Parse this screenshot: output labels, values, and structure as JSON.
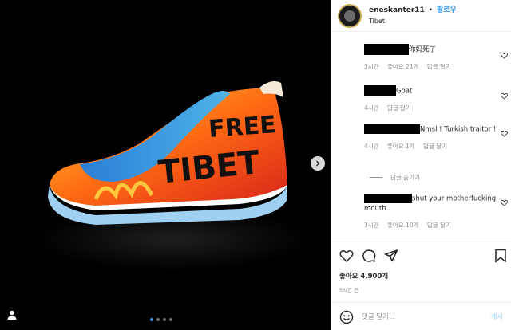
{
  "header": {
    "username": "eneskanter11",
    "separator": "•",
    "follow_label": "팔로우",
    "location": "Tibet"
  },
  "media": {
    "shoe_text_line1": "FREE",
    "shoe_text_line2": "TIBET",
    "carousel_total": 4,
    "carousel_active": 1
  },
  "comments": [
    {
      "text": "你妈死了",
      "time": "3시간",
      "likes": "좋아요 21개",
      "reply": "답글 달기"
    },
    {
      "text": "Goat",
      "time": "4시간",
      "reply": "답글 달기"
    },
    {
      "text": "Nmsl ! Turkish traitor !",
      "time": "4시간",
      "likes": "좋아요 1개",
      "reply": "답글 달기"
    },
    {
      "text": "shut your motherfucking mouth",
      "time": "3시간",
      "likes": "좋아요 10개",
      "reply": "답글 달기"
    }
  ],
  "replies_toggle": "답글 숨기기",
  "actions": {
    "likes": "좋아요 4,900개",
    "time": "5시간 전"
  },
  "comment_box": {
    "placeholder": "댓글 달기...",
    "post_label": "게시"
  },
  "colors": {
    "accent": "#3897f0",
    "muted": "#8e8e8e",
    "post_disabled": "#b2dffc"
  }
}
